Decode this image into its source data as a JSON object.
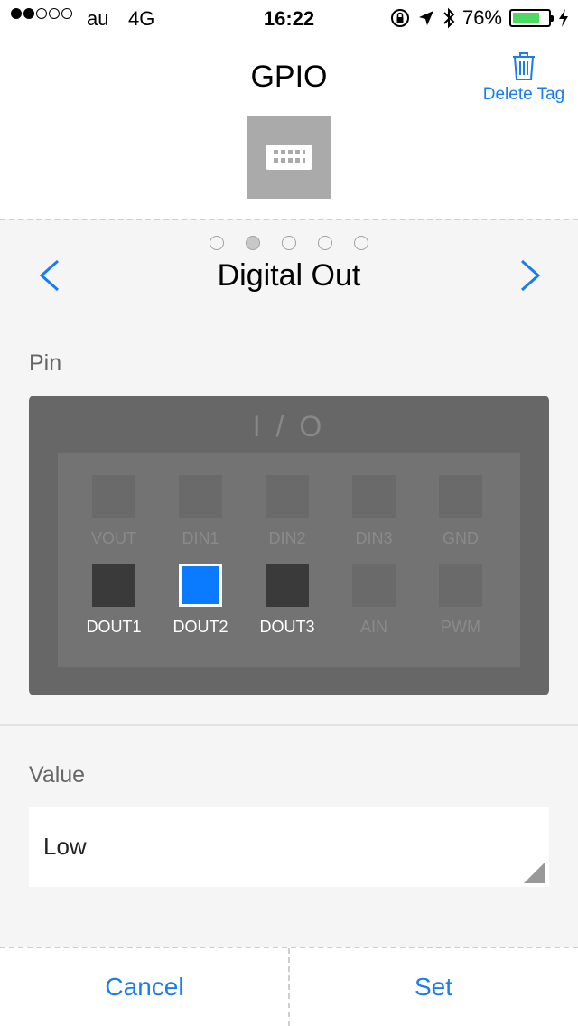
{
  "status_bar": {
    "carrier": "au",
    "network": "4G",
    "time": "16:22",
    "battery_percent": "76%",
    "battery_level": 0.76,
    "signal_bars": 2,
    "icons": [
      "rotation-lock-icon",
      "location-icon",
      "bluetooth-icon",
      "charging-icon"
    ]
  },
  "header": {
    "title": "GPIO",
    "delete_tag_label": "Delete Tag",
    "delete_icon": "trash-icon",
    "tag_icon": "keyboard-icon"
  },
  "pager": {
    "count": 5,
    "active_index": 1
  },
  "mode": {
    "title": "Digital Out",
    "prev_icon": "chevron-left-icon",
    "next_icon": "chevron-right-icon"
  },
  "pin_section": {
    "label": "Pin",
    "board_title": "I / O",
    "pins_row1": [
      "VOUT",
      "DIN1",
      "DIN2",
      "DIN3",
      "GND"
    ],
    "pins_row2": [
      "DOUT1",
      "DOUT2",
      "DOUT3",
      "AIN",
      "PWM"
    ],
    "selected_pin": "DOUT2"
  },
  "value_section": {
    "label": "Value",
    "selected_value": "Low"
  },
  "footer": {
    "cancel_label": "Cancel",
    "set_label": "Set"
  },
  "colors": {
    "accent": "#1a7cf0",
    "selected_pin": "#0a7bff",
    "board": "#676767",
    "battery": "#4cd964"
  }
}
